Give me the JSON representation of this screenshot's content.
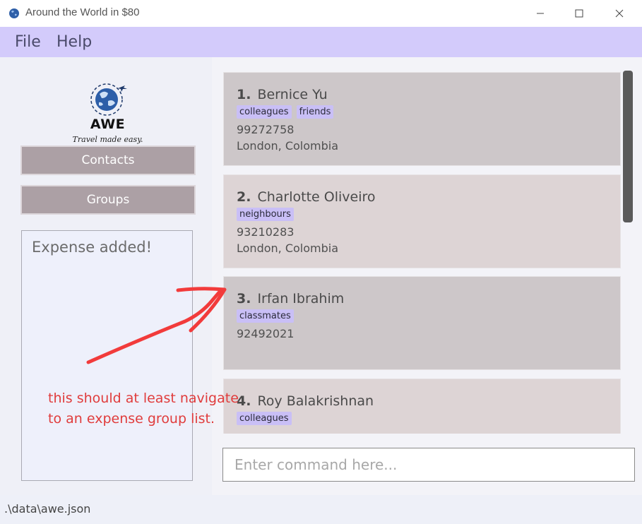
{
  "window": {
    "title": "Around the World in $80",
    "icon": "globe-icon",
    "controls": [
      "minimize-icon",
      "maximize-icon",
      "close-icon"
    ]
  },
  "menu": {
    "items": [
      {
        "label": "File"
      },
      {
        "label": "Help"
      }
    ]
  },
  "sidebar": {
    "logo": {
      "name": "AWE",
      "tagline": "Travel made easy."
    },
    "buttons": [
      {
        "label": "Contacts"
      },
      {
        "label": "Groups"
      }
    ],
    "result_message": "Expense added!"
  },
  "contacts": [
    {
      "index": "1.",
      "name": "Bernice Yu",
      "tags": [
        "colleagues",
        "friends"
      ],
      "phone": "99272758",
      "address": "London, Colombia"
    },
    {
      "index": "2.",
      "name": "Charlotte Oliveiro",
      "tags": [
        "neighbours"
      ],
      "phone": "93210283",
      "address": "London, Colombia"
    },
    {
      "index": "3.",
      "name": "Irfan Ibrahim",
      "tags": [
        "classmates"
      ],
      "phone": "92492021",
      "address": ""
    },
    {
      "index": "4.",
      "name": "Roy Balakrishnan",
      "tags": [
        "colleagues"
      ],
      "phone": "",
      "address": ""
    }
  ],
  "annotation": {
    "lines": [
      "this should at least navigate",
      "to an expense group list."
    ],
    "color": "#e03c3c"
  },
  "command": {
    "placeholder": "Enter command here...",
    "value": ""
  },
  "status_bar": {
    "path": ".\\data\\awe.json"
  },
  "colors": {
    "menu_bg": "#d3cbfb",
    "tag_bg": "#c9bff6",
    "nav_button_bg": "#aca0a5",
    "card_bg": "#cdc7c9",
    "card_alt_bg": "#ddd4d5"
  }
}
